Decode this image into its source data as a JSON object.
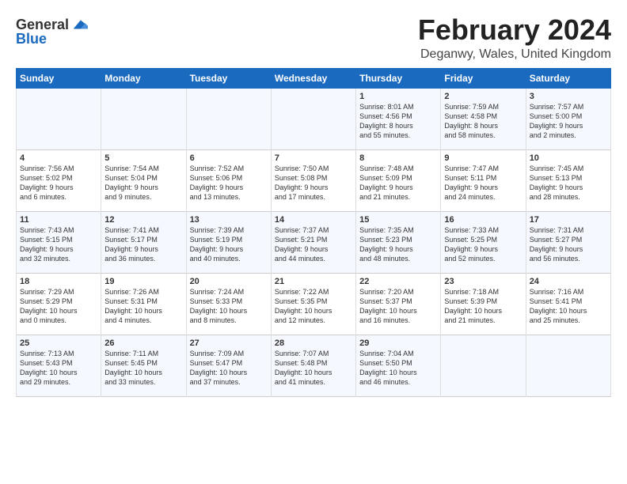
{
  "logo": {
    "general": "General",
    "blue": "Blue"
  },
  "title": "February 2024",
  "subtitle": "Deganwy, Wales, United Kingdom",
  "headers": [
    "Sunday",
    "Monday",
    "Tuesday",
    "Wednesday",
    "Thursday",
    "Friday",
    "Saturday"
  ],
  "weeks": [
    [
      {
        "day": "",
        "content": ""
      },
      {
        "day": "",
        "content": ""
      },
      {
        "day": "",
        "content": ""
      },
      {
        "day": "",
        "content": ""
      },
      {
        "day": "1",
        "content": "Sunrise: 8:01 AM\nSunset: 4:56 PM\nDaylight: 8 hours\nand 55 minutes."
      },
      {
        "day": "2",
        "content": "Sunrise: 7:59 AM\nSunset: 4:58 PM\nDaylight: 8 hours\nand 58 minutes."
      },
      {
        "day": "3",
        "content": "Sunrise: 7:57 AM\nSunset: 5:00 PM\nDaylight: 9 hours\nand 2 minutes."
      }
    ],
    [
      {
        "day": "4",
        "content": "Sunrise: 7:56 AM\nSunset: 5:02 PM\nDaylight: 9 hours\nand 6 minutes."
      },
      {
        "day": "5",
        "content": "Sunrise: 7:54 AM\nSunset: 5:04 PM\nDaylight: 9 hours\nand 9 minutes."
      },
      {
        "day": "6",
        "content": "Sunrise: 7:52 AM\nSunset: 5:06 PM\nDaylight: 9 hours\nand 13 minutes."
      },
      {
        "day": "7",
        "content": "Sunrise: 7:50 AM\nSunset: 5:08 PM\nDaylight: 9 hours\nand 17 minutes."
      },
      {
        "day": "8",
        "content": "Sunrise: 7:48 AM\nSunset: 5:09 PM\nDaylight: 9 hours\nand 21 minutes."
      },
      {
        "day": "9",
        "content": "Sunrise: 7:47 AM\nSunset: 5:11 PM\nDaylight: 9 hours\nand 24 minutes."
      },
      {
        "day": "10",
        "content": "Sunrise: 7:45 AM\nSunset: 5:13 PM\nDaylight: 9 hours\nand 28 minutes."
      }
    ],
    [
      {
        "day": "11",
        "content": "Sunrise: 7:43 AM\nSunset: 5:15 PM\nDaylight: 9 hours\nand 32 minutes."
      },
      {
        "day": "12",
        "content": "Sunrise: 7:41 AM\nSunset: 5:17 PM\nDaylight: 9 hours\nand 36 minutes."
      },
      {
        "day": "13",
        "content": "Sunrise: 7:39 AM\nSunset: 5:19 PM\nDaylight: 9 hours\nand 40 minutes."
      },
      {
        "day": "14",
        "content": "Sunrise: 7:37 AM\nSunset: 5:21 PM\nDaylight: 9 hours\nand 44 minutes."
      },
      {
        "day": "15",
        "content": "Sunrise: 7:35 AM\nSunset: 5:23 PM\nDaylight: 9 hours\nand 48 minutes."
      },
      {
        "day": "16",
        "content": "Sunrise: 7:33 AM\nSunset: 5:25 PM\nDaylight: 9 hours\nand 52 minutes."
      },
      {
        "day": "17",
        "content": "Sunrise: 7:31 AM\nSunset: 5:27 PM\nDaylight: 9 hours\nand 56 minutes."
      }
    ],
    [
      {
        "day": "18",
        "content": "Sunrise: 7:29 AM\nSunset: 5:29 PM\nDaylight: 10 hours\nand 0 minutes."
      },
      {
        "day": "19",
        "content": "Sunrise: 7:26 AM\nSunset: 5:31 PM\nDaylight: 10 hours\nand 4 minutes."
      },
      {
        "day": "20",
        "content": "Sunrise: 7:24 AM\nSunset: 5:33 PM\nDaylight: 10 hours\nand 8 minutes."
      },
      {
        "day": "21",
        "content": "Sunrise: 7:22 AM\nSunset: 5:35 PM\nDaylight: 10 hours\nand 12 minutes."
      },
      {
        "day": "22",
        "content": "Sunrise: 7:20 AM\nSunset: 5:37 PM\nDaylight: 10 hours\nand 16 minutes."
      },
      {
        "day": "23",
        "content": "Sunrise: 7:18 AM\nSunset: 5:39 PM\nDaylight: 10 hours\nand 21 minutes."
      },
      {
        "day": "24",
        "content": "Sunrise: 7:16 AM\nSunset: 5:41 PM\nDaylight: 10 hours\nand 25 minutes."
      }
    ],
    [
      {
        "day": "25",
        "content": "Sunrise: 7:13 AM\nSunset: 5:43 PM\nDaylight: 10 hours\nand 29 minutes."
      },
      {
        "day": "26",
        "content": "Sunrise: 7:11 AM\nSunset: 5:45 PM\nDaylight: 10 hours\nand 33 minutes."
      },
      {
        "day": "27",
        "content": "Sunrise: 7:09 AM\nSunset: 5:47 PM\nDaylight: 10 hours\nand 37 minutes."
      },
      {
        "day": "28",
        "content": "Sunrise: 7:07 AM\nSunset: 5:48 PM\nDaylight: 10 hours\nand 41 minutes."
      },
      {
        "day": "29",
        "content": "Sunrise: 7:04 AM\nSunset: 5:50 PM\nDaylight: 10 hours\nand 46 minutes."
      },
      {
        "day": "",
        "content": ""
      },
      {
        "day": "",
        "content": ""
      }
    ]
  ]
}
